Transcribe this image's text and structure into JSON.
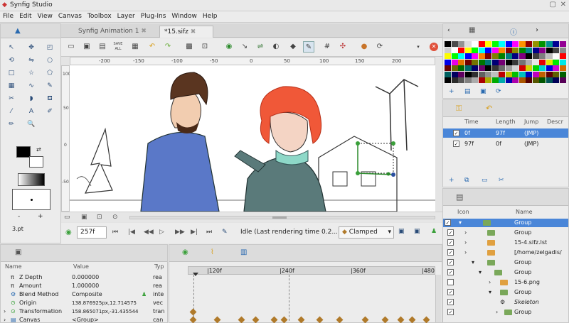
{
  "window": {
    "title": "Synfig Studio"
  },
  "menu": [
    "File",
    "Edit",
    "View",
    "Canvas",
    "Toolbox",
    "Layer",
    "Plug-Ins",
    "Window",
    "Help"
  ],
  "doc_tabs": [
    {
      "label": "Synfig Animation 1"
    },
    {
      "label": "*15.sifz"
    }
  ],
  "toolbar": {
    "save_all": "SAVE ALL"
  },
  "ruler": {
    "h_ticks": [
      "-200",
      "-150",
      "-100",
      "-50",
      "0",
      "50",
      "100",
      "150",
      "200"
    ],
    "v_ticks": [
      "100",
      "50",
      "0",
      "-50"
    ]
  },
  "canvas_bottom": {
    "frame": "257f",
    "status": "Idle (Last rendering time 0.2...",
    "interp": "Clamped"
  },
  "toolbox": {
    "brush_size": "3.pt"
  },
  "params": {
    "headers": {
      "name": "Name",
      "value": "Value",
      "type": "Typ"
    },
    "rows": [
      {
        "icon": "π",
        "name": "Z Depth",
        "value": "0.000000",
        "type": "rea"
      },
      {
        "icon": "π",
        "name": "Amount",
        "value": "1.000000",
        "type": "rea"
      },
      {
        "icon": "⚙",
        "name": "Blend Method",
        "value": "Composite",
        "type": "inte"
      },
      {
        "icon": "⊙",
        "name": "Origin",
        "value": "138.876925px,12.714575",
        "type": "vec"
      },
      {
        "icon": "⊙",
        "name": "Transformation",
        "value": "158.865071px,-31.435544",
        "type": "tran"
      },
      {
        "icon": "▤",
        "name": "Canvas",
        "value": "<Group>",
        "type": "can"
      }
    ]
  },
  "timeline": {
    "marks": [
      "|120f",
      "|240f",
      "|360f",
      "|480"
    ]
  },
  "keyframes": {
    "headers": {
      "time": "Time",
      "length": "Length",
      "jump": "Jump",
      "desc": "Descr"
    },
    "rows": [
      {
        "time": "0f",
        "length": "97f",
        "jump": "(JMP)"
      },
      {
        "time": "97f",
        "length": "0f",
        "jump": "(JMP)"
      }
    ]
  },
  "layers": {
    "headers": {
      "icon": "Icon",
      "name": "Name"
    },
    "rows": [
      {
        "name": "Group"
      },
      {
        "name": "Group"
      },
      {
        "name": "15-4.sifz.lst"
      },
      {
        "name": "[/home/zelgadis/"
      },
      {
        "name": "Group"
      },
      {
        "name": "Group"
      },
      {
        "name": "15-6.png"
      },
      {
        "name": "Group"
      },
      {
        "name": "Skeleton"
      },
      {
        "name": "Group"
      }
    ]
  },
  "palette_colors": [
    "#000000",
    "#404040",
    "#808080",
    "#c0c0c0",
    "#ffffff",
    "#ff0000",
    "#ffff00",
    "#00ff00",
    "#00ffff",
    "#0000ff",
    "#ff00ff",
    "#ff8000",
    "#800000",
    "#808000",
    "#008000",
    "#008080",
    "#000080",
    "#800080"
  ]
}
